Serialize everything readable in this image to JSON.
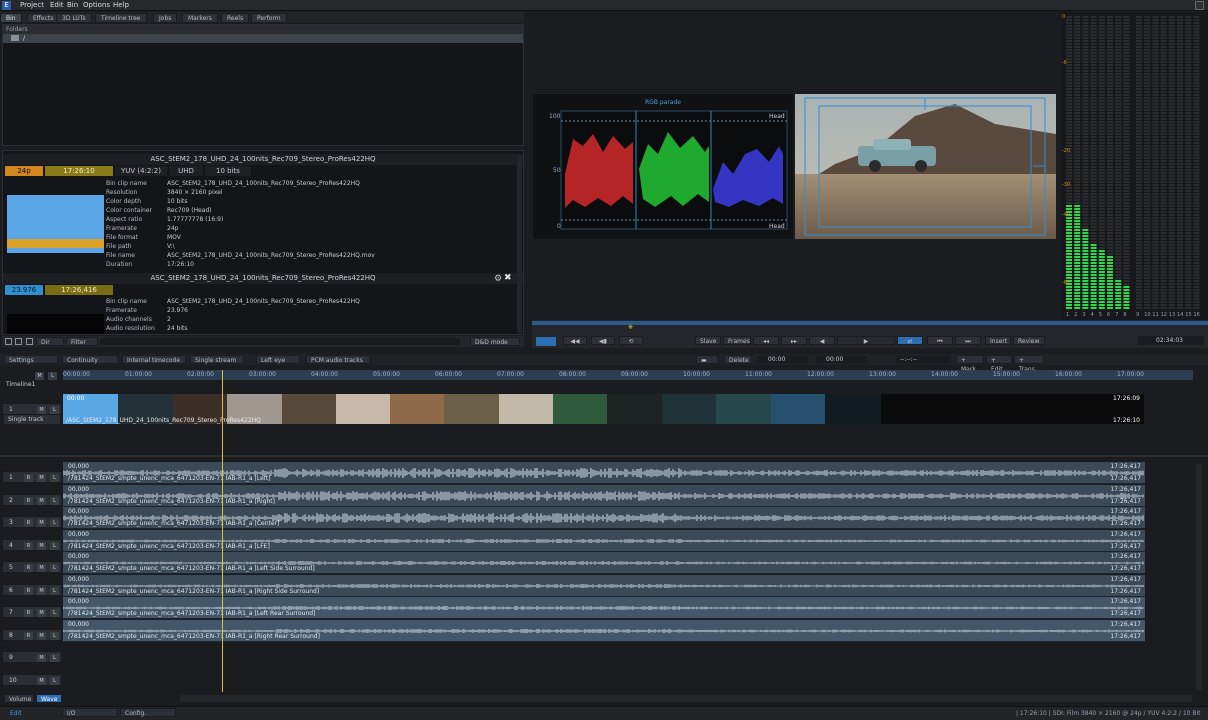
{
  "menu": {
    "items": [
      "Project",
      "Edit",
      "Bin",
      "Options",
      "Help"
    ]
  },
  "bin_tabs": [
    "Bin",
    "Effects",
    "3D LUTs",
    "Timeline tree",
    "Jobs",
    "Markers",
    "Reels",
    "Perform"
  ],
  "folders": {
    "header": "Folders",
    "root": "/"
  },
  "clip1": {
    "title": "ASC_StEM2_178_UHD_24_100nits_Rec709_Stereo_ProRes422HQ",
    "chips": [
      "24p",
      "17:26:10",
      "YUV (4:2:2)",
      "UHD",
      "10 bits"
    ],
    "fields": [
      {
        "k": "Bin clip name",
        "v": "ASC_StEM2_178_UHD_24_100nits_Rec709_Stereo_ProRes422HQ"
      },
      {
        "k": "Resolution",
        "v": "3840 × 2160 pixel"
      },
      {
        "k": "Color depth",
        "v": "10 bits"
      },
      {
        "k": "Color container",
        "v": "Rec709 (Head)"
      },
      {
        "k": "Aspect ratio",
        "v": "1.77777778 (16:9)"
      },
      {
        "k": "Framerate",
        "v": "24p"
      },
      {
        "k": "File format",
        "v": "MOV"
      },
      {
        "k": "File path",
        "v": "V:\\"
      },
      {
        "k": "File name",
        "v": "ASC_StEM2_178_UHD_24_100nits_Rec709_Stereo_ProRes422HQ.mov"
      },
      {
        "k": "Duration",
        "v": "17:26:10"
      }
    ]
  },
  "clip2": {
    "title": "ASC_StEM2_178_UHD_24_100nits_Rec709_Stereo_ProRes422HQ",
    "chips": [
      "23.976",
      "17:26,416"
    ],
    "fields": [
      {
        "k": "Bin clip name",
        "v": "ASC_StEM2_178_UHD_24_100nits_Rec709_Stereo_ProRes422HQ"
      },
      {
        "k": "Framerate",
        "v": "23.976"
      },
      {
        "k": "Audio channels",
        "v": "2"
      },
      {
        "k": "Audio resolution",
        "v": "24 bits"
      }
    ]
  },
  "bin_toolbar": {
    "dir": "Dir",
    "filter": "Filter",
    "mode": "D&D mode"
  },
  "scope": {
    "title": "RGB parade",
    "head_label": "Head",
    "y_ticks": [
      "100",
      "50",
      "0"
    ]
  },
  "meters": {
    "scale": [
      "0",
      "-6",
      "-20",
      "-30",
      "-40",
      "-60"
    ],
    "channels": [
      "1",
      "2",
      "3",
      "4",
      "5",
      "6",
      "7",
      "8",
      "9",
      "10",
      "11",
      "12",
      "13",
      "14",
      "15",
      "16"
    ]
  },
  "transport": {
    "slave": "Slave",
    "frames": "Frames",
    "insert": "Insert",
    "review": "Review",
    "timecode": "02:34:03"
  },
  "timeline_toolbar": {
    "settings": "Settings",
    "continuity": "Continuity",
    "internal_tc": "Internal timecode",
    "single_stream": "Single stream",
    "left_eye": "Left eye",
    "pcm": "PCM audio tracks",
    "delete": "Delete",
    "tc_in": "00:00",
    "tc_out": "00:00",
    "dashes": "--:--:--",
    "mark": "+ Mark",
    "edit": "+ Edit",
    "trans": "+ Trans"
  },
  "timeline": {
    "name": "Timeline1",
    "track_mode": "Single track",
    "ruler": [
      "00:00:00",
      "01:00:00",
      "02:00:00",
      "03:00:00",
      "04:00:00",
      "05:00:00",
      "06:00:00",
      "07:00:00",
      "08:00:00",
      "09:00:00",
      "10:00:00",
      "11:00:00",
      "12:00:00",
      "13:00:00",
      "14:00:00",
      "15:00:00",
      "16:00:00",
      "17:00:00"
    ]
  },
  "video_clip": {
    "start": "00:00",
    "name": "/ASC_StEM2_178_UHD_24_100nits_Rec709_Stereo_ProRes422HQ",
    "end1": "17:26:09",
    "end2": "17:26:10"
  },
  "audio_tracks": [
    {
      "num": "1",
      "start": "00,000",
      "name": "/781424_StEM2_smpte_unenc_mca_6471203-EN-71 IAB-R1_a [Left]",
      "end": "17:26,417"
    },
    {
      "num": "2",
      "start": "00,000",
      "name": "/781424_StEM2_smpte_unenc_mca_6471203-EN-71 IAB-R1_a [Right]",
      "end": "17:26,417"
    },
    {
      "num": "3",
      "start": "00,000",
      "name": "/781424_StEM2_smpte_unenc_mca_6471203-EN-71 IAB-R1_a [Center]",
      "end": "17:26,417"
    },
    {
      "num": "4",
      "start": "00,000",
      "name": "/781424_StEM2_smpte_unenc_mca_6471203-EN-71 IAB-R1_a [LFE]",
      "end": "17:26,417"
    },
    {
      "num": "5",
      "start": "00,000",
      "name": "/781424_StEM2_smpte_unenc_mca_6471203-EN-71 IAB-R1_a [Left Side Surround]",
      "end": "17:26,417"
    },
    {
      "num": "6",
      "start": "00,000",
      "name": "/781424_StEM2_smpte_unenc_mca_6471203-EN-71 IAB-R1_a [Right Side Surround]",
      "end": "17:26,417"
    },
    {
      "num": "7",
      "start": "00,000",
      "name": "/781424_StEM2_smpte_unenc_mca_6471203-EN-71 IAB-R1_a [Left Rear Surround]",
      "end": "17:26,417"
    },
    {
      "num": "8",
      "start": "00,000",
      "name": "/781424_StEM2_smpte_unenc_mca_6471203-EN-71 IAB-R1_a [Right Rear Surround]",
      "end": "17:26,417"
    }
  ],
  "empty_tracks": [
    "9",
    "10"
  ],
  "bottom_tabs": {
    "volume": "Volume",
    "wave": "Wave",
    "io": "I/O",
    "config": "Config."
  },
  "status": {
    "edit": "Edit",
    "right": "| 17:26:10 | SDI: Film 3840 × 2160 @ 24p / YUV 4:2:2 / 10 Bit"
  },
  "btn": {
    "r": "R",
    "m": "M",
    "l": "L"
  }
}
